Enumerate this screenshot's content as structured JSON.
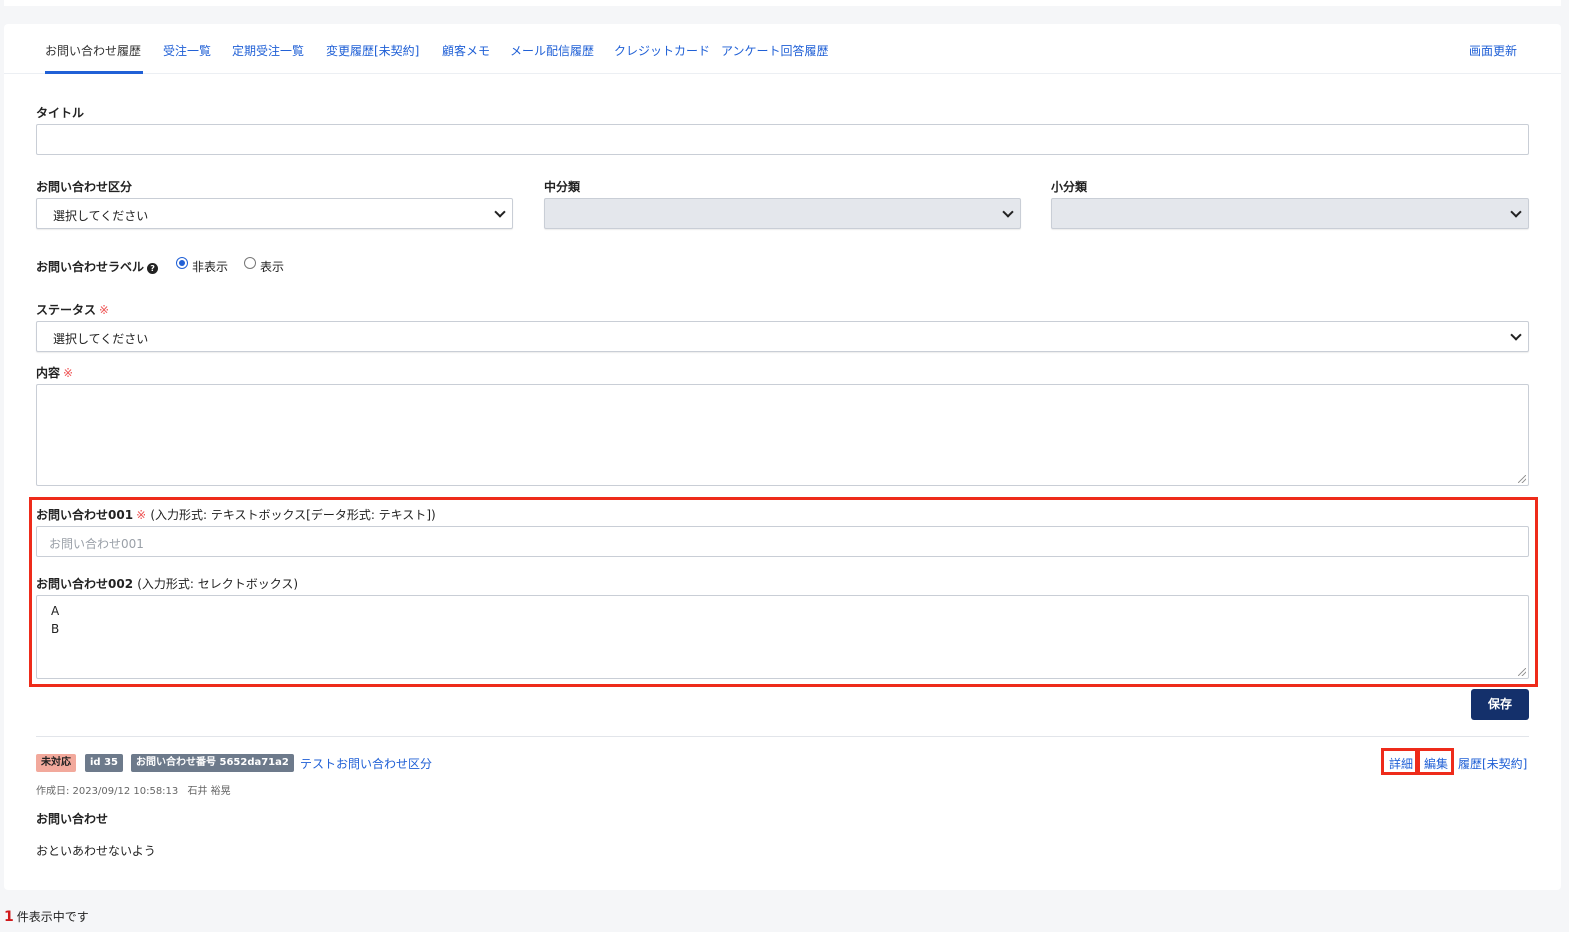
{
  "tabs": [
    "お問い合わせ履歴",
    "受注一覧",
    "定期受注一覧",
    "変更履歴[未契約]",
    "顧客メモ",
    "メール配信履歴",
    "クレジットカード",
    "アンケート回答履歴"
  ],
  "refresh_label": "画面更新",
  "form": {
    "title_label": "タイトル",
    "title_value": "",
    "category_label": "お問い合わせ区分",
    "category_value": "選択してください",
    "mid_label": "中分類",
    "mid_value": "",
    "small_label": "小分類",
    "small_value": "",
    "inquiry_label_label": "お問い合わせラベル",
    "help_icon": "?",
    "radio_hide": "非表示",
    "radio_show": "表示",
    "status_label": "ステータス",
    "required_mark": "※",
    "status_value": "選択してください",
    "content_label": "内容",
    "content_value": "",
    "field001_label": "お問い合わせ001",
    "field001_note": "(入力形式: テキストボックス[データ形式: テキスト])",
    "field001_placeholder": "お問い合わせ001",
    "field002_label": "お問い合わせ002",
    "field002_note": "(入力形式: セレクトボックス)",
    "field002_options": [
      "A",
      "B"
    ],
    "save_label": "保存"
  },
  "record": {
    "status_badge": "未対応",
    "id_badge": "id 35",
    "number_badge": "お問い合わせ番号 5652da71a2",
    "category_link": "テストお問い合わせ区分",
    "created": "作成日: 2023/09/12 10:58:13",
    "author": "石井 裕晃",
    "section_title": "お問い合わせ",
    "body": "おといあわせないよう",
    "detail_label": "詳細",
    "edit_label": "編集",
    "history_label": "履歴[未契約]"
  },
  "footer": {
    "count": "1",
    "count_suffix": "件表示中です"
  }
}
